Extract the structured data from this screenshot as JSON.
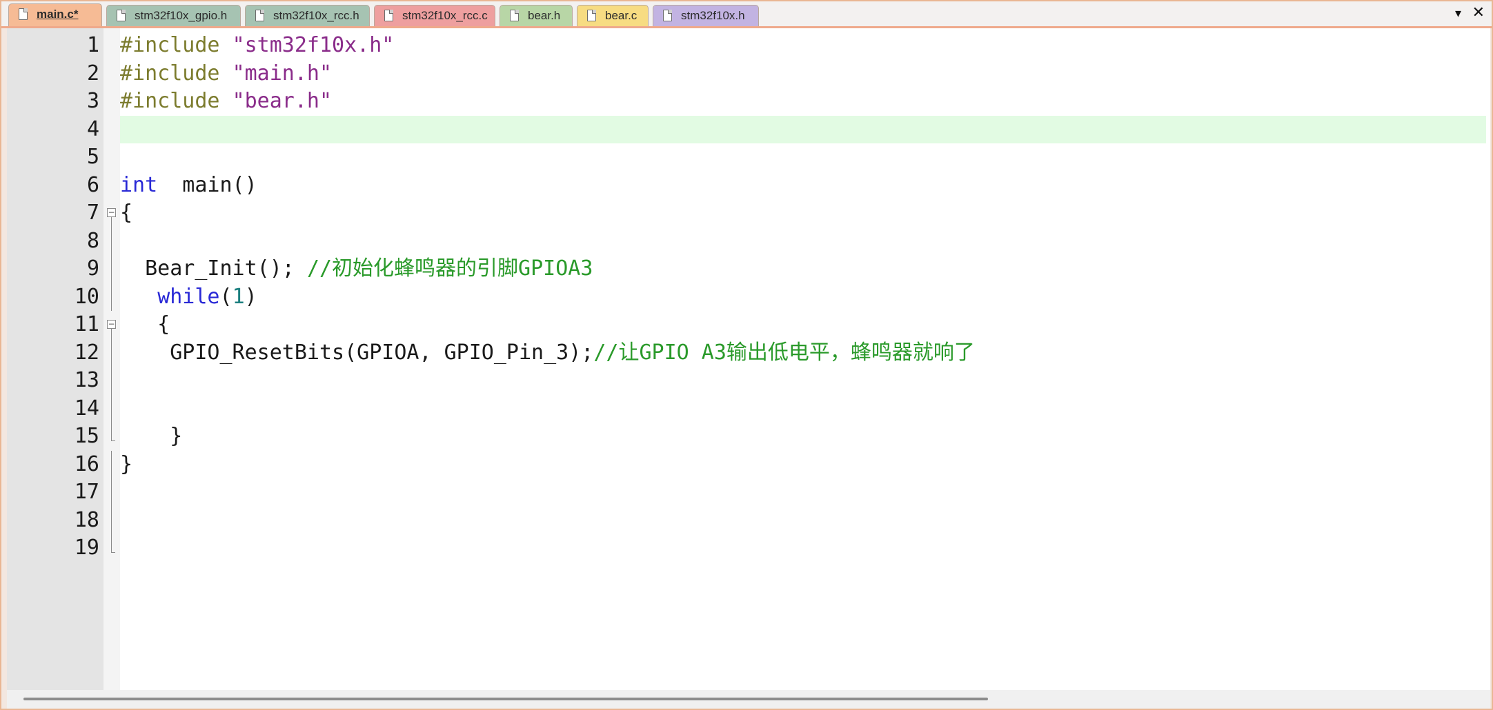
{
  "tabs": [
    {
      "label": "main.c*",
      "active": true,
      "color": "#f6bb95",
      "left": 0,
      "width": 0
    },
    {
      "label": "stm32f10x_gpio.h",
      "active": false,
      "color": "#a6c3b2"
    },
    {
      "label": "stm32f10x_rcc.h",
      "active": false,
      "color": "#a6c3b2"
    },
    {
      "label": "stm32f10x_rcc.c",
      "active": false,
      "color": "#ee9f9f"
    },
    {
      "label": "bear.h",
      "active": false,
      "color": "#b8d6a6"
    },
    {
      "label": "bear.c",
      "active": false,
      "color": "#f7dc82"
    },
    {
      "label": "stm32f10x.h",
      "active": false,
      "color": "#c2b3e2"
    }
  ],
  "tabbar_menu_icon": "▾",
  "tabbar_close_icon": "✕",
  "current_line": 4,
  "lines": [
    {
      "n": "1",
      "tokens": [
        {
          "t": "pp",
          "v": "#include "
        },
        {
          "t": "str",
          "v": "\"stm32f10x.h\""
        }
      ]
    },
    {
      "n": "2",
      "tokens": [
        {
          "t": "pp",
          "v": "#include "
        },
        {
          "t": "str",
          "v": "\"main.h\""
        }
      ]
    },
    {
      "n": "3",
      "tokens": [
        {
          "t": "pp",
          "v": "#include "
        },
        {
          "t": "str",
          "v": "\"bear.h\""
        }
      ]
    },
    {
      "n": "4",
      "tokens": []
    },
    {
      "n": "5",
      "tokens": []
    },
    {
      "n": "6",
      "tokens": [
        {
          "t": "kw",
          "v": "int"
        },
        {
          "t": "pl",
          "v": "  main()"
        }
      ]
    },
    {
      "n": "7",
      "tokens": [
        {
          "t": "pl",
          "v": "{"
        }
      ]
    },
    {
      "n": "8",
      "tokens": []
    },
    {
      "n": "9",
      "tokens": [
        {
          "t": "pl",
          "v": "  Bear_Init(); "
        },
        {
          "t": "cm",
          "v": "//初始化蜂鸣器的引脚GPIOA3"
        }
      ]
    },
    {
      "n": "10",
      "tokens": [
        {
          "t": "pl",
          "v": "   "
        },
        {
          "t": "kw",
          "v": "while"
        },
        {
          "t": "pl",
          "v": "("
        },
        {
          "t": "num",
          "v": "1"
        },
        {
          "t": "pl",
          "v": ")"
        }
      ]
    },
    {
      "n": "11",
      "tokens": [
        {
          "t": "pl",
          "v": "   {"
        }
      ]
    },
    {
      "n": "12",
      "tokens": [
        {
          "t": "pl",
          "v": "    GPIO_ResetBits(GPIOA, GPIO_Pin_3);"
        },
        {
          "t": "cm",
          "v": "//让GPIO A3输出低电平，蜂鸣器就响了"
        }
      ]
    },
    {
      "n": "13",
      "tokens": []
    },
    {
      "n": "14",
      "tokens": []
    },
    {
      "n": "15",
      "tokens": [
        {
          "t": "pl",
          "v": "    }"
        }
      ]
    },
    {
      "n": "16",
      "tokens": [
        {
          "t": "pl",
          "v": "}"
        }
      ]
    },
    {
      "n": "17",
      "tokens": []
    },
    {
      "n": "18",
      "tokens": []
    },
    {
      "n": "19",
      "tokens": []
    }
  ],
  "folds": {
    "7": "box",
    "8": "line",
    "9": "line",
    "10": "line",
    "11": "box",
    "12": "line",
    "13": "line",
    "14": "line",
    "15": "end",
    "16": "line",
    "17": "line",
    "18": "line",
    "19": "end"
  }
}
